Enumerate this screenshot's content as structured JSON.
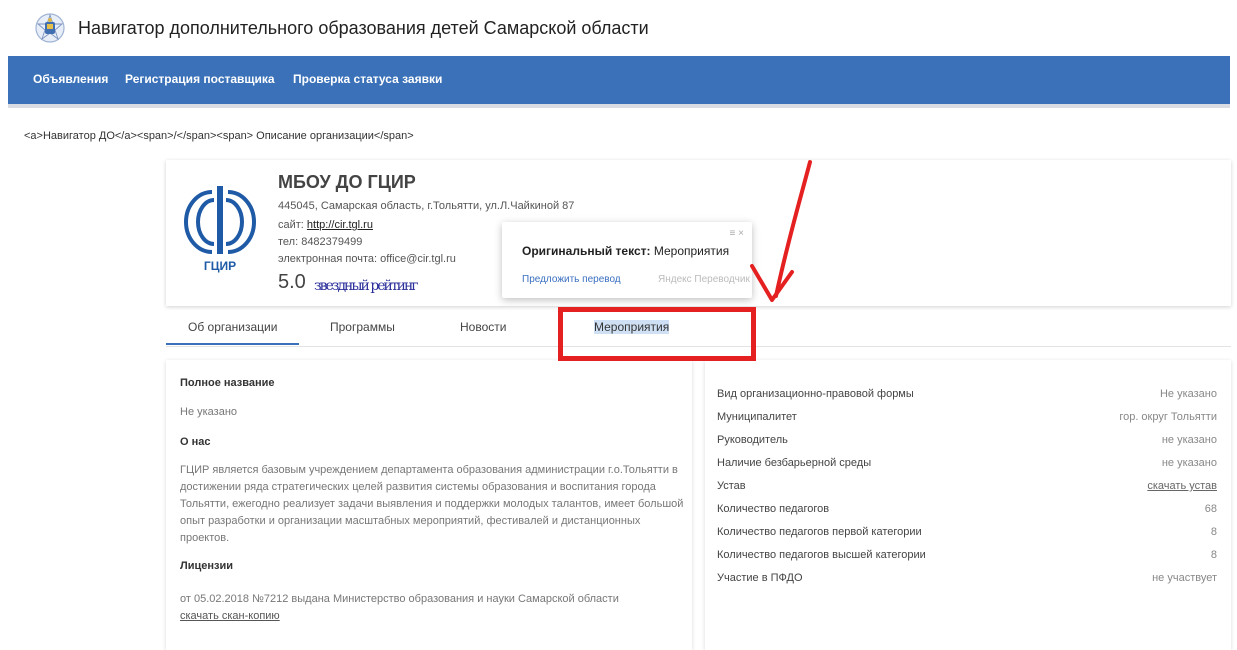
{
  "header": {
    "title": "Навигатор дополнительного образования детей Самарской области"
  },
  "nav": {
    "items": [
      "Объявления",
      "Регистрация поставщика",
      "Проверка статуса заявки"
    ]
  },
  "breadcrumb": "<a>Навигатор ДО</a><span>/</span><span> Описание организации</span>",
  "org": {
    "name": "МБОУ ДО ГЦИР",
    "logo_text": "ГЦИР",
    "address": "445045, Самарская область, г.Тольятти, ул.Л.Чайкиной 87",
    "site_label": "сайт: ",
    "site_url": "http://cir.tgl.ru",
    "phone": "тел: 8482379499",
    "email": "электронная почта: office@cir.tgl.ru",
    "rating": "5.0",
    "rating_garbled": "звездный рейтинг"
  },
  "translate_popup": {
    "label": "Оригинальный текст:",
    "original": "Мероприятия",
    "suggest": "Предложить перевод",
    "brand": "Яндекс Переводчик",
    "controls": "≡ ×"
  },
  "tabs": [
    "Об организации",
    "Программы",
    "Новости",
    "Мероприятия"
  ],
  "about": {
    "full_name_label": "Полное название",
    "full_name_value": "Не указано",
    "about_label": "О нас",
    "about_text": "ГЦИР является базовым учреждением департамента образования администрации г.о.Тольятти в достижении ряда стратегических целей развития системы образования и воспитания города Тольятти, ежегодно реализует задачи выявления и поддержки молодых талантов, имеет большой опыт разработки и организации масштабных мероприятий, фестивалей и дистанционных проектов.",
    "licenses_label": "Лицензии",
    "license_text": "от 05.02.2018 №7212 выдана Министерство образования и науки Самарской области",
    "scan_link": "скачать скан-копию"
  },
  "details": [
    {
      "label": "Вид организационно-правовой формы",
      "value": "Не указано"
    },
    {
      "label": "Муниципалитет",
      "value": "гор. округ Тольятти"
    },
    {
      "label": "Руководитель",
      "value": "не указано"
    },
    {
      "label": "Наличие безбарьерной среды",
      "value": "не указано"
    },
    {
      "label": "Устав",
      "value": "скачать устав"
    },
    {
      "label": "Количество педагогов",
      "value": "68"
    },
    {
      "label": "Количество педагогов первой категории",
      "value": "8"
    },
    {
      "label": "Количество педагогов высшей категории",
      "value": "8"
    },
    {
      "label": "Участие в ПФДО",
      "value": "не участвует"
    }
  ],
  "colors": {
    "nav_bg": "#3a71b8",
    "annotation": "#e52020",
    "tab_underline": "#3a71b8"
  }
}
